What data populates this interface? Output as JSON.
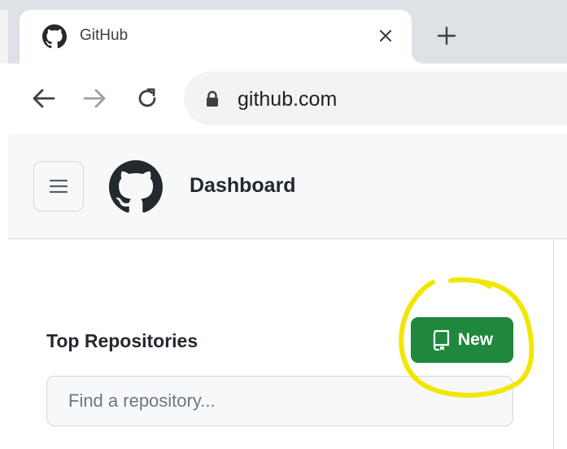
{
  "browser": {
    "tab": {
      "title": "GitHub",
      "favicon": "github-icon",
      "close_icon": "close-icon"
    },
    "new_tab_icon": "plus-icon",
    "nav": {
      "back_icon": "arrow-left-icon",
      "forward_icon": "arrow-right-icon",
      "reload_icon": "reload-icon"
    },
    "omnibox": {
      "lock_icon": "lock-icon",
      "url": "github.com"
    }
  },
  "header": {
    "menu_icon": "hamburger-icon",
    "logo_icon": "github-icon",
    "title": "Dashboard"
  },
  "sidebar": {
    "heading": "Top Repositories",
    "new_button": {
      "label": "New",
      "icon": "repo-icon"
    },
    "search": {
      "value": "",
      "placeholder": "Find a repository..."
    }
  },
  "annotation": {
    "shape": "hand-drawn circle",
    "target": "new-button",
    "color": "#f2e600"
  },
  "colors": {
    "tabstrip": "#dee1e6",
    "header_bg": "#f6f8fa",
    "primary_button": "#1f883d",
    "text": "#24292f",
    "border": "#d0d7de"
  }
}
